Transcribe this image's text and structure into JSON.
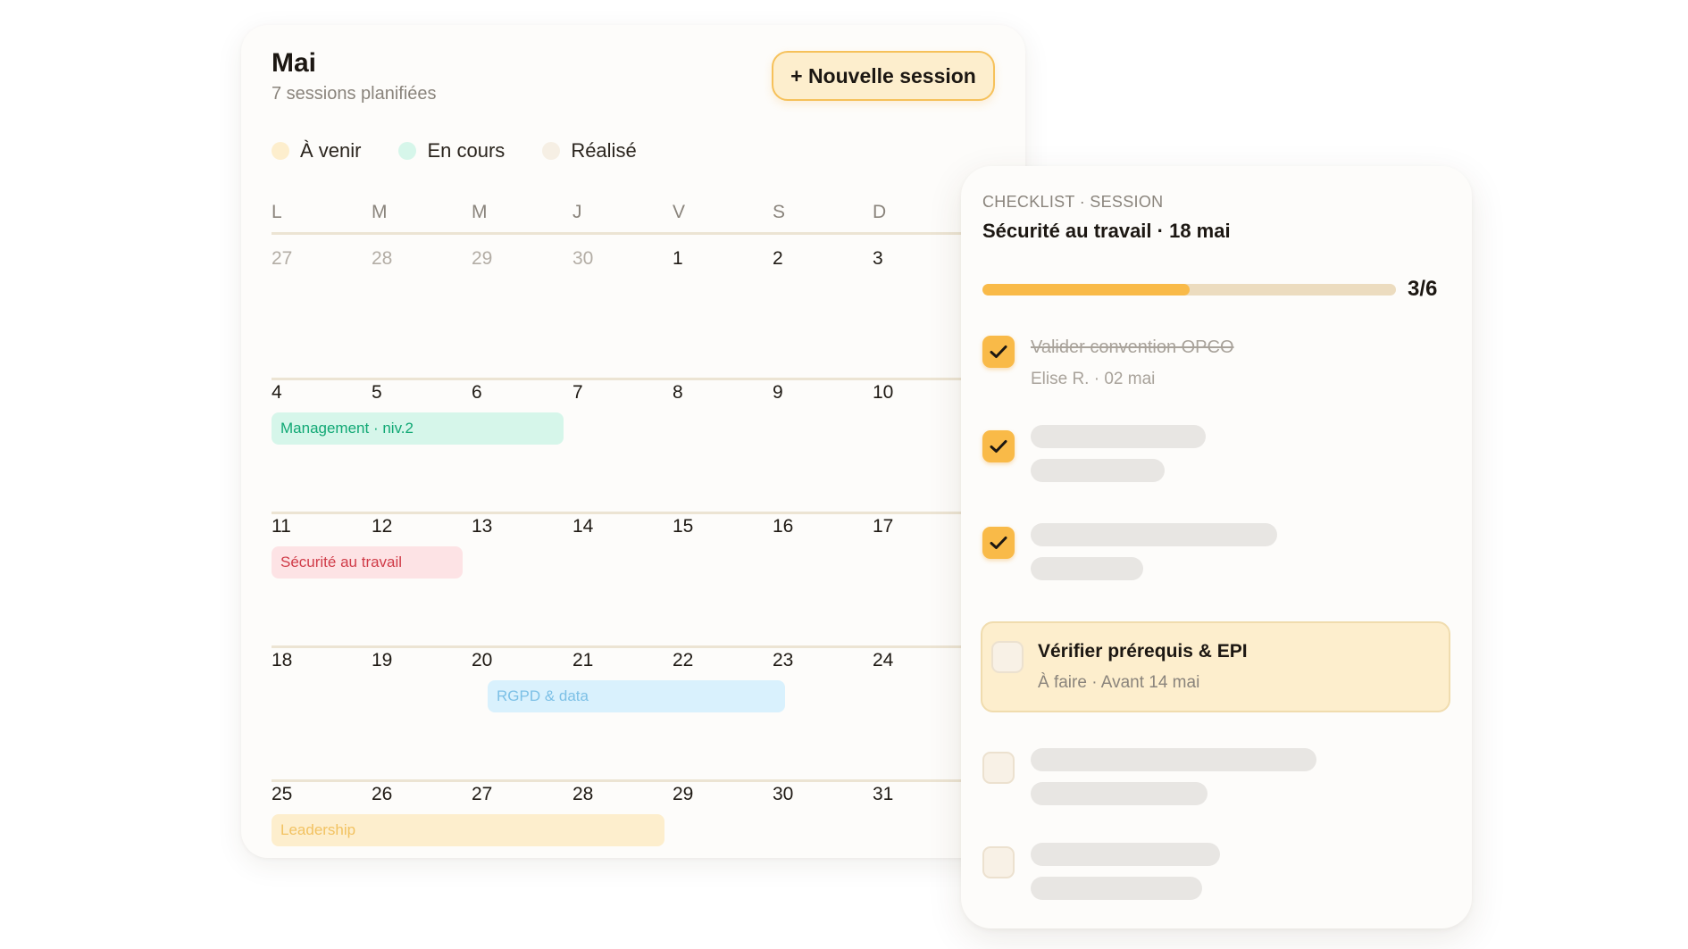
{
  "calendar": {
    "month": "Mai",
    "subtitle": "7 sessions planifiées",
    "new_button": "+ Nouvelle session",
    "legend": [
      {
        "label": "À venir",
        "color": "#fdeecd"
      },
      {
        "label": "En cours",
        "color": "#d6f6ea"
      },
      {
        "label": "Réalisé",
        "color": "#f6efe4"
      }
    ],
    "weekdays": [
      "L",
      "M",
      "M",
      "J",
      "V",
      "S",
      "D"
    ],
    "weeks": [
      {
        "days": [
          "27",
          "28",
          "29",
          "30",
          "1",
          "2",
          "3"
        ]
      },
      {
        "days": [
          "4",
          "5",
          "6",
          "7",
          "8",
          "9",
          "10"
        ],
        "event": {
          "label": "Management · niv.2",
          "bg": "#d6f6ea",
          "fg": "#10a874"
        }
      },
      {
        "days": [
          "11",
          "12",
          "13",
          "14",
          "15",
          "16",
          "17"
        ],
        "event": {
          "label": "Sécurité au travail",
          "bg": "#fde3e5",
          "fg": "#d03b48"
        }
      },
      {
        "days": [
          "18",
          "19",
          "20",
          "21",
          "22",
          "23",
          "24"
        ],
        "event": {
          "label": "RGPD & data",
          "bg": "#d9f1fd",
          "fg": "#7cc0e6"
        }
      },
      {
        "days": [
          "25",
          "26",
          "27",
          "28",
          "29",
          "30",
          "31"
        ],
        "event": {
          "label": "Leadership",
          "bg": "#fdeecd",
          "fg": "#f2c261"
        }
      }
    ]
  },
  "checklist": {
    "eyebrow": "CHECKLIST · SESSION",
    "title": "Sécurité au travail · 18 mai",
    "progress_fraction": 0.5,
    "progress_label": "3/6",
    "items": [
      {
        "label": "Valider convention OPCO",
        "meta": "Elise R. · 02 mai",
        "checked": true
      },
      {
        "checked": true
      },
      {
        "checked": true
      },
      {
        "label": "Vérifier prérequis & EPI",
        "meta": "À faire · Avant 14 mai",
        "checked": false
      },
      {
        "checked": false
      },
      {
        "checked": false
      }
    ]
  },
  "colors": {
    "accent": "#f9ba48",
    "accent_soft": "#fdeecd",
    "muted_text": "#8a847c"
  }
}
